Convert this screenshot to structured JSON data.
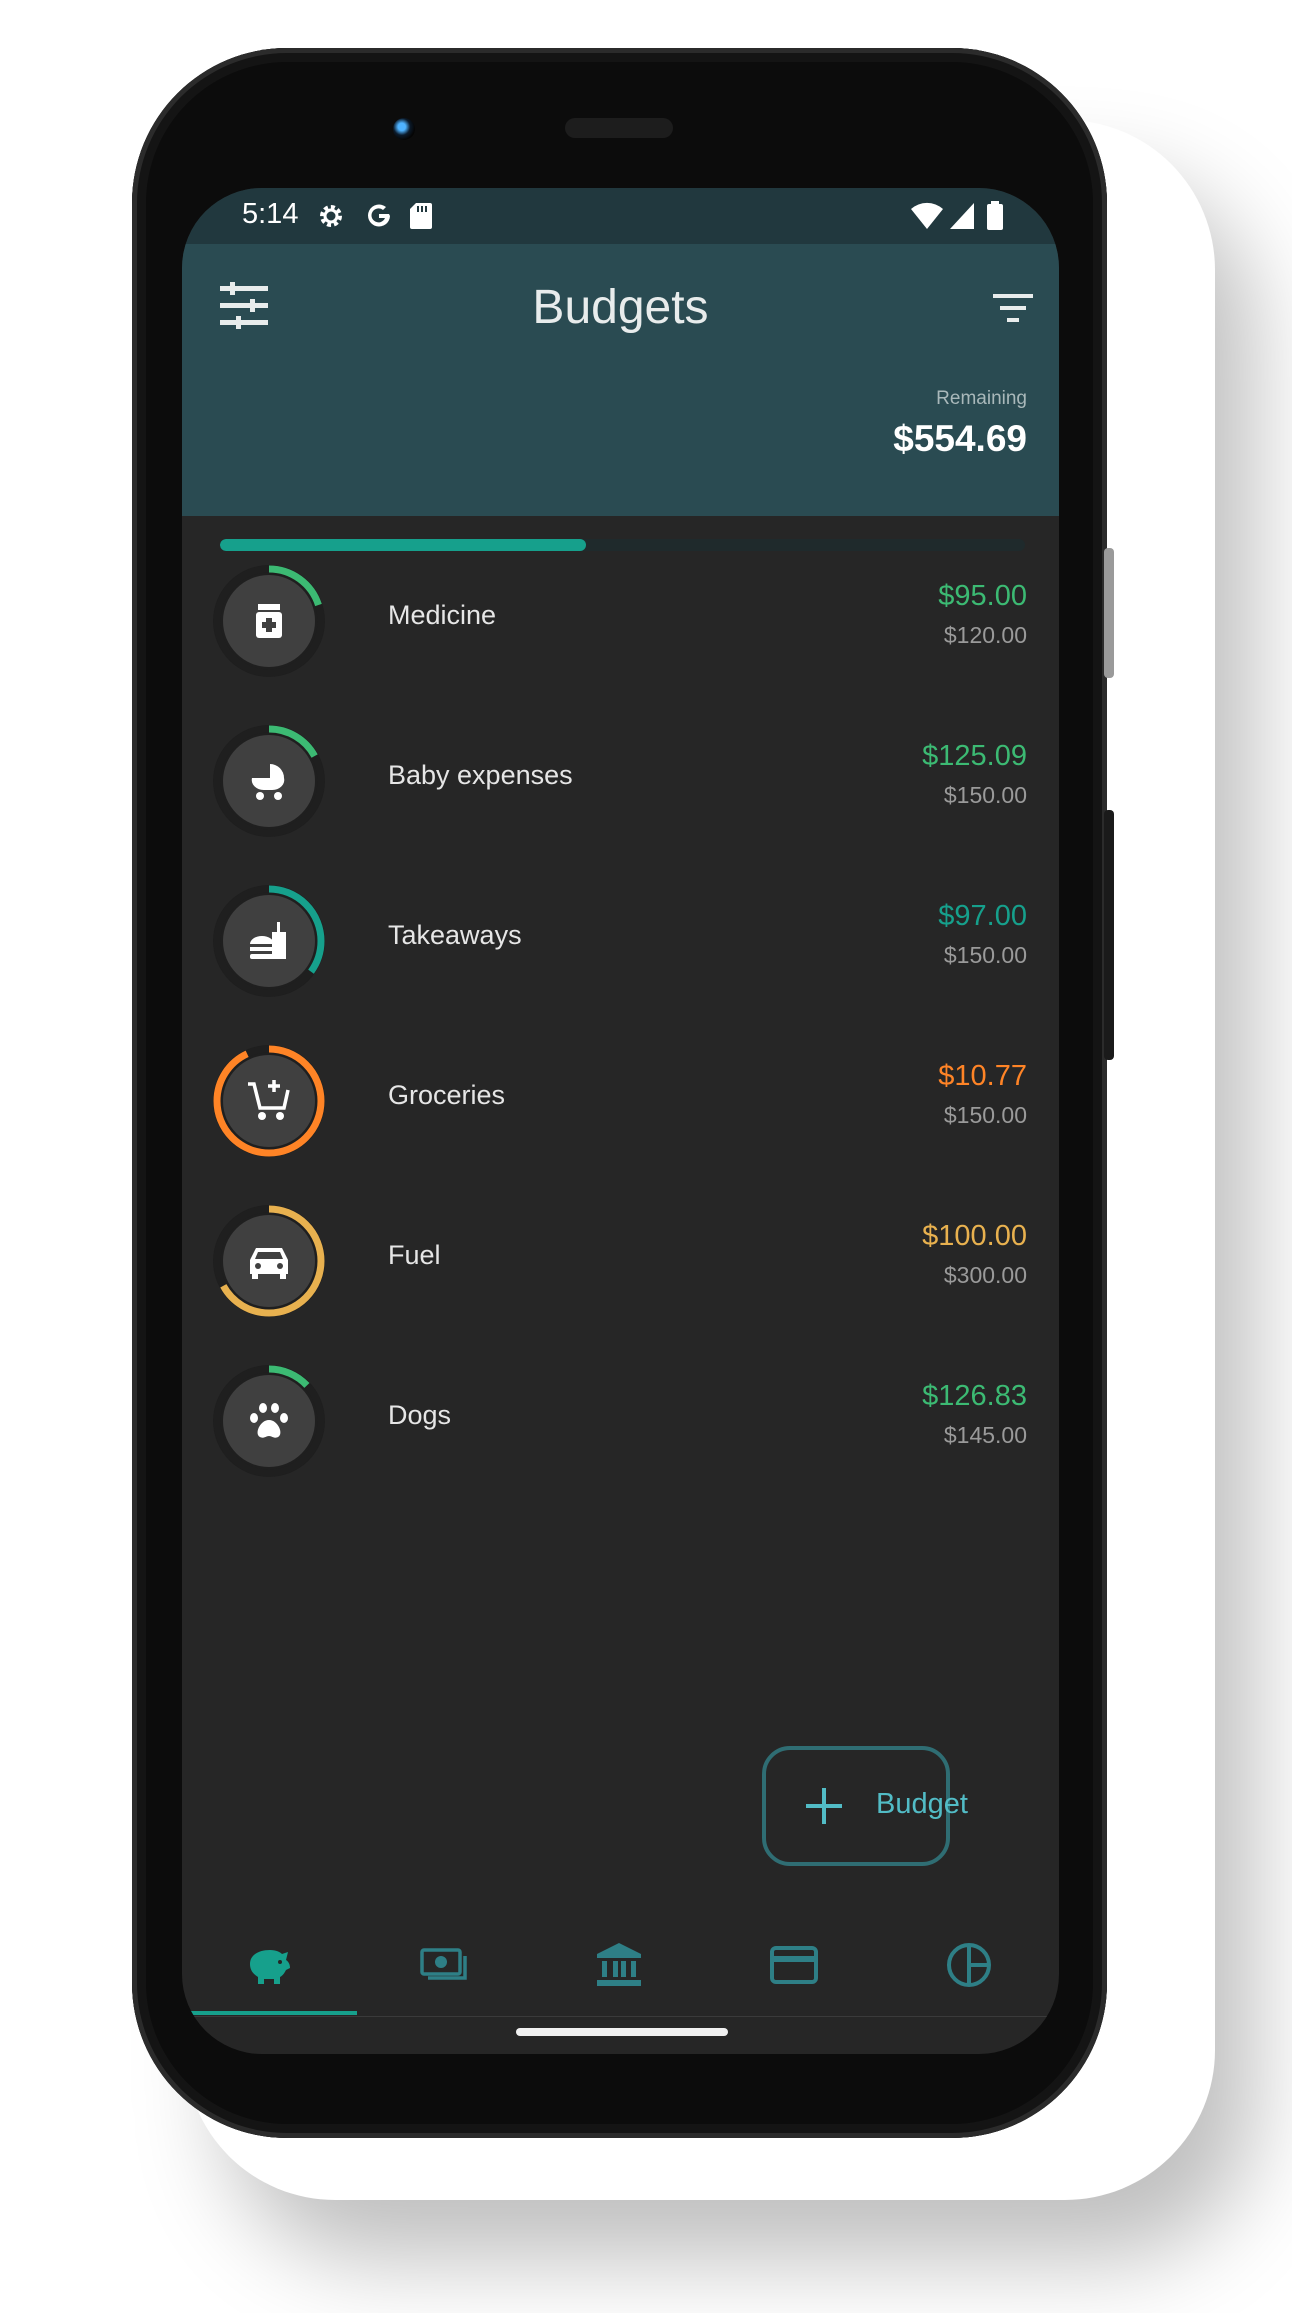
{
  "status_bar": {
    "time": "5:14",
    "icons": [
      "settings-gear-icon",
      "google-g-icon",
      "sd-card-icon",
      "wifi-icon",
      "cell-signal-icon",
      "battery-icon"
    ]
  },
  "header": {
    "title": "Budgets",
    "remaining_label": "Remaining",
    "remaining_value": "$554.69",
    "progress_fraction": 0.455,
    "progress_color": "#16a08c"
  },
  "budgets": [
    {
      "name": "Medicine",
      "amount": "$95.00",
      "budget": "$120.00",
      "color": "#3cba73",
      "icon": "medicine-bottle-icon",
      "ring_fraction": 0.2
    },
    {
      "name": "Baby expenses",
      "amount": "$125.09",
      "budget": "$150.00",
      "color": "#3cba73",
      "icon": "baby-stroller-icon",
      "ring_fraction": 0.17
    },
    {
      "name": "Takeaways",
      "amount": "$97.00",
      "budget": "$150.00",
      "color": "#16a08c",
      "icon": "fast-food-icon",
      "ring_fraction": 0.35
    },
    {
      "name": "Groceries",
      "amount": "$10.77",
      "budget": "$150.00",
      "color": "#ff8426",
      "icon": "add-shopping-cart-icon",
      "ring_fraction": 0.93
    },
    {
      "name": "Fuel",
      "amount": "$100.00",
      "budget": "$300.00",
      "color": "#e8b14f",
      "icon": "car-icon",
      "ring_fraction": 0.67
    },
    {
      "name": "Dogs",
      "amount": "$126.83",
      "budget": "$145.00",
      "color": "#3cba73",
      "icon": "paw-icon",
      "ring_fraction": 0.13
    }
  ],
  "fab": {
    "label": "Budget",
    "icon": "plus-icon"
  },
  "bottom_nav": [
    {
      "icon": "piggy-bank-icon",
      "active": true
    },
    {
      "icon": "money-icon",
      "active": false
    },
    {
      "icon": "bank-icon",
      "active": false
    },
    {
      "icon": "credit-card-icon",
      "active": false
    },
    {
      "icon": "pie-chart-icon",
      "active": false
    }
  ],
  "colors": {
    "accent": "#16a08c",
    "header_bg": "#2a4b52",
    "screen_bg": "#262626"
  }
}
